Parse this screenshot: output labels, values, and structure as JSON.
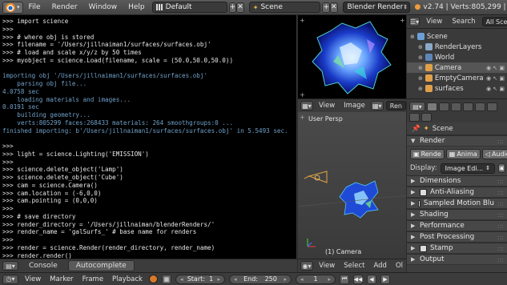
{
  "topbar": {
    "menus": [
      "File",
      "Render",
      "Window",
      "Help"
    ],
    "layout": "Default",
    "scene": "Scene",
    "engine": "Blender Render",
    "stats": "v2.74 | Verts:805,299 | F"
  },
  "console": {
    "lines": [
      {
        "t": ">>> import science",
        "k": "input"
      },
      {
        "t": ">>>",
        "k": "input"
      },
      {
        "t": ">>> # where obj is stored",
        "k": "input"
      },
      {
        "t": ">>> filename = '/Users/jillnaiman1/surfaces/surfaces.obj'",
        "k": "input"
      },
      {
        "t": ">>> # load and scale x/y/z by 50 times",
        "k": "input"
      },
      {
        "t": ">>> myobject = science.Load(filename, scale = (50.0,50.0,50.0))",
        "k": "input"
      },
      {
        "t": "",
        "k": "out"
      },
      {
        "t": "importing obj '/Users/jillnaiman1/surfaces/surfaces.obj'",
        "k": "info"
      },
      {
        "t": "    parsing obj file...",
        "k": "info"
      },
      {
        "t": "4.0758 sec",
        "k": "info"
      },
      {
        "t": "    loading materials and images...",
        "k": "info"
      },
      {
        "t": "0.0191 sec",
        "k": "info"
      },
      {
        "t": "    building geometry...",
        "k": "info"
      },
      {
        "t": "    verts:805299 faces:268433 materials: 264 smoothgroups:0 ...",
        "k": "info"
      },
      {
        "t": "finished importing: b'/Users/jillnaiman1/surfaces/surfaces.obj' in 5.5493 sec.",
        "k": "info"
      },
      {
        "t": "",
        "k": "out"
      },
      {
        "t": ">>>",
        "k": "input"
      },
      {
        "t": ">>> light = science.Lighting('EMISSION')",
        "k": "input"
      },
      {
        "t": ">>>",
        "k": "input"
      },
      {
        "t": ">>> science.delete_object('Lamp')",
        "k": "input"
      },
      {
        "t": ">>> science.delete_object('Cube')",
        "k": "input"
      },
      {
        "t": ">>> cam = science.Camera()",
        "k": "input"
      },
      {
        "t": ">>> cam.location = (-6,0,0)",
        "k": "input"
      },
      {
        "t": ">>> cam.pointing = (0,0,0)",
        "k": "input"
      },
      {
        "t": ">>>",
        "k": "input"
      },
      {
        "t": ">>> # save directory",
        "k": "input"
      },
      {
        "t": ">>> render_directory = '/Users/jillnaiman/blenderRenders/'",
        "k": "input"
      },
      {
        "t": ">>> render_name = 'galSurfs_' # base name for renders",
        "k": "input"
      },
      {
        "t": ">>>",
        "k": "input"
      },
      {
        "t": ">>> render = science.Render(render_directory, render_name)",
        "k": "input"
      },
      {
        "t": ">>> render.render()",
        "k": "input"
      }
    ],
    "prompt": ">>> ",
    "footer_tabs": [
      "Console",
      "Autocomplete"
    ]
  },
  "image_editor": {
    "view": "View",
    "image": "Image",
    "rend": "Ren"
  },
  "viewport": {
    "label_persp": "User Persp",
    "label_camera": "(1) Camera",
    "menus": [
      "View",
      "Select",
      "Add",
      "Ol"
    ]
  },
  "outliner": {
    "view": "View",
    "search": "Search",
    "all_scenes": "All Scen",
    "rows": [
      {
        "label": "Scene",
        "indent": 0,
        "icon": "#6aa0d8"
      },
      {
        "label": "RenderLayers",
        "indent": 1,
        "icon": "#8aa8c8"
      },
      {
        "label": "World",
        "indent": 1,
        "icon": "#5d86b8"
      },
      {
        "label": "Camera",
        "indent": 1,
        "icon": "#e0a04a",
        "sel": true
      },
      {
        "label": "EmptyCamera",
        "indent": 1,
        "icon": "#e0a04a"
      },
      {
        "label": "surfaces",
        "indent": 1,
        "icon": "#e0a04a"
      }
    ]
  },
  "properties": {
    "crumb": "Scene",
    "render_panel": "Render",
    "render_btn": "Rende",
    "anim_btn": "Anima",
    "audio_btn": "Audio",
    "display_label": "Display:",
    "display_value": "Image Edi...",
    "panels": [
      {
        "label": "Dimensions",
        "check": false
      },
      {
        "label": "Anti-Aliasing",
        "check": true
      },
      {
        "label": "Sampled Motion Blu",
        "check": true
      },
      {
        "label": "Shading",
        "check": false
      },
      {
        "label": "Performance",
        "check": false
      },
      {
        "label": "Post Processing",
        "check": false
      },
      {
        "label": "Stamp",
        "check": true
      },
      {
        "label": "Output",
        "check": false
      }
    ]
  },
  "timeline": {
    "menus": [
      "View",
      "Marker",
      "Frame",
      "Playback"
    ],
    "start_label": "Start:",
    "start_value": "1",
    "end_label": "End:",
    "end_value": "250",
    "current": "1"
  }
}
